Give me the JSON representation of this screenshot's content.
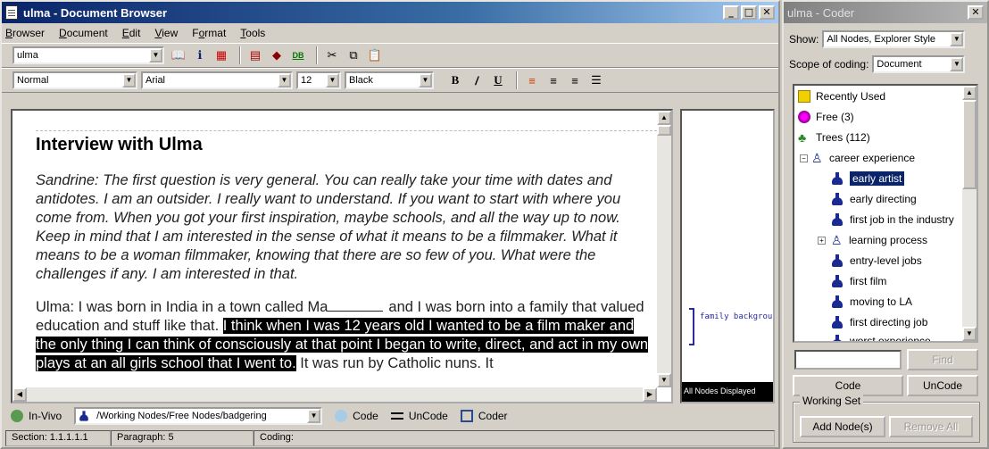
{
  "browser": {
    "title": "ulma - Document Browser",
    "menus": [
      "Browser",
      "Document",
      "Edit",
      "View",
      "Format",
      "Tools"
    ],
    "menu_underlines": [
      "B",
      "D",
      "E",
      "V",
      "o",
      "T"
    ],
    "doc_select": "ulma",
    "style_select": "Normal",
    "font_select": "Arial",
    "size_select": "12",
    "color_select": "Black",
    "db_label": "DB",
    "doc": {
      "title": "Interview with Ulma",
      "question": "Sandrine:  The first question is very general.  You can really take your time with dates and antidotes.  I am an outsider.  I really want to understand. If you want to start with where you come from.  When you got your first inspiration, maybe schools, and all the way up to now.  Keep in mind that I am interested in the sense of what it means to be a filmmaker.  What it means to be a woman filmmaker, knowing that there are so few of you.  What were the challenges if any.  I am interested in that.",
      "answer_pre": "Ulma:  I was born in India in a town called Ma",
      "answer_mid": "and I was born into a family that valued education and stuff like that. ",
      "answer_highlight": "I think when I was 12 years old I wanted to be a film maker and the only thing I can think of consciously at that point I began to write, direct, and act in my own plays at an all girls school that I went to.",
      "answer_post": " It was run by Catholic nuns.  It"
    },
    "margin": {
      "code": "family backgrou",
      "footer": "All Nodes Displayed"
    },
    "codebar": {
      "invivo": "In-Vivo",
      "node_path": "/Working Nodes/Free Nodes/badgering",
      "code": "Code",
      "uncode": "UnCode",
      "coder": "Coder"
    },
    "status": {
      "section": "Section: 1.1.1.1.1",
      "paragraph": "Paragraph: 5",
      "coding": "Coding:"
    }
  },
  "coder": {
    "title": "ulma - Coder",
    "show_label": "Show:",
    "show_value": "All Nodes, Explorer Style",
    "scope_label": "Scope of coding:",
    "scope_value": "Document",
    "tree": {
      "recent": "Recently Used",
      "free": "Free (3)",
      "trees": "Trees (112)",
      "career": "career experience",
      "children": [
        "early artist",
        "early directing",
        "first job in the industry",
        "learning process",
        "entry-level jobs",
        "first film",
        "moving to LA",
        "first directing job",
        "worst experience"
      ]
    },
    "find_button": "Find",
    "code_button": "Code",
    "uncode_button": "UnCode",
    "working_set_label": "Working Set",
    "add_nodes_button": "Add Node(s)",
    "remove_all_button": "Remove All"
  },
  "colors": {
    "title_active": "#0a246a",
    "selection": "#0a246a",
    "face": "#d4d0c8"
  }
}
